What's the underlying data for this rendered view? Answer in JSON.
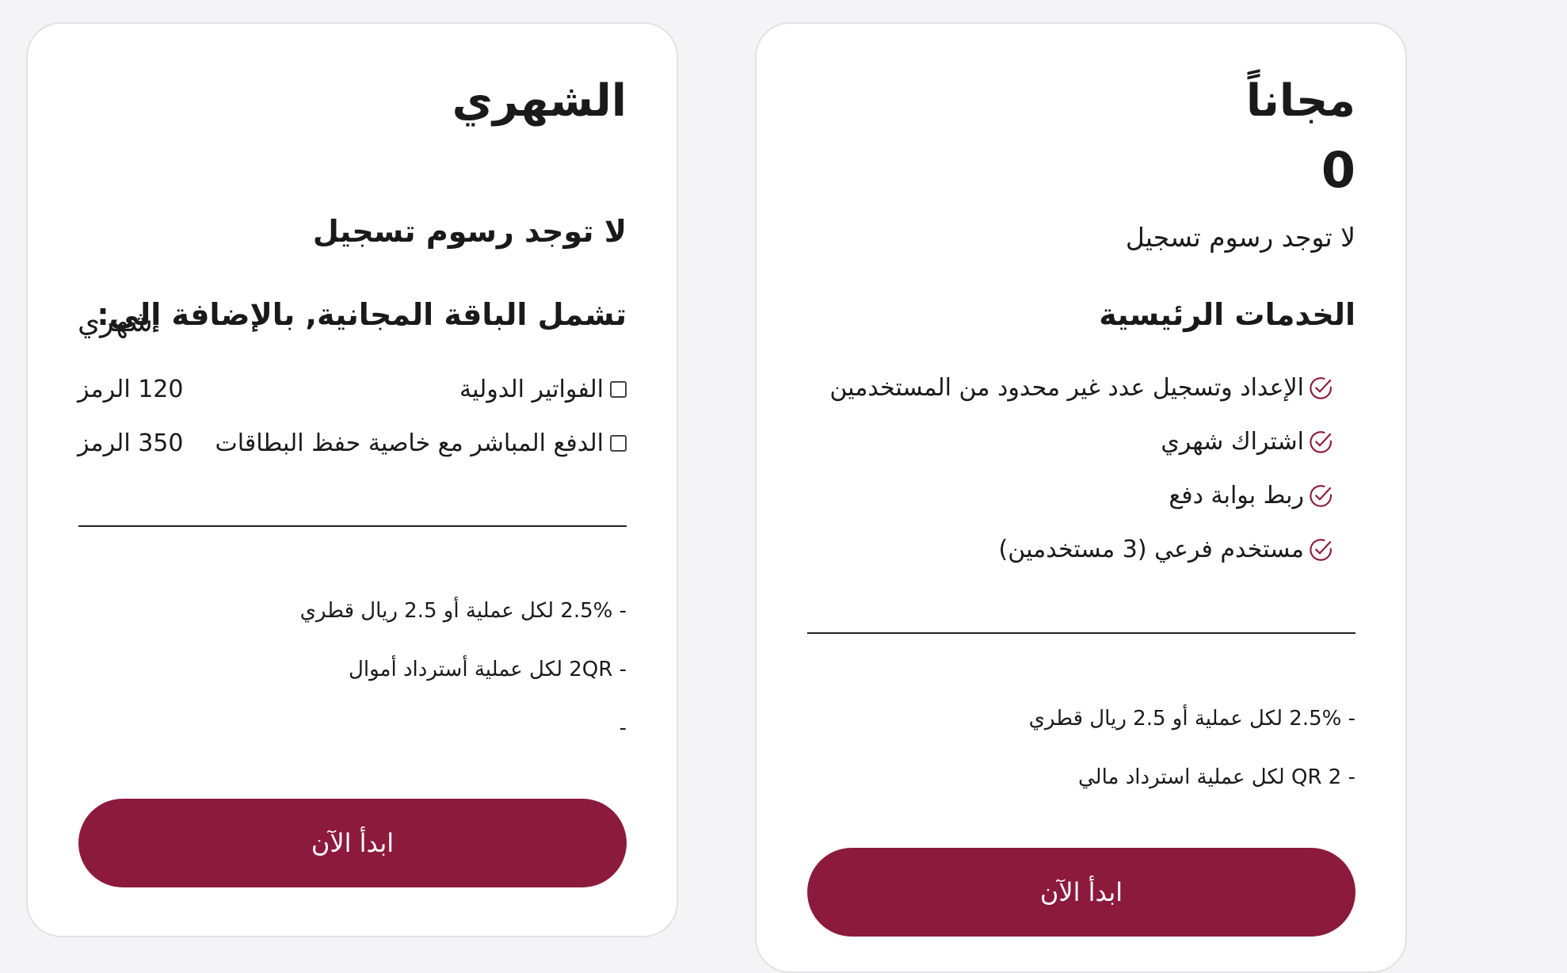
{
  "monthly": {
    "title": "الشهري",
    "no_fee": "لا توجد رسوم تسجيل",
    "includes_heading": "تشمل الباقة المجانية, بالإضافة إلى:",
    "period_label": "شهري",
    "addons": [
      {
        "label": "الفواتير الدولية",
        "price": "120 الرمز"
      },
      {
        "label": "الدفع المباشر مع خاصية حفظ البطاقات",
        "price": "350 الرمز"
      }
    ],
    "fees": [
      "- 2.5% لكل عملية أو 2.5 ريال قطري",
      "- 2QR لكل عملية أسترداد أموال",
      "-"
    ],
    "cta": "ابدأ الآن"
  },
  "free": {
    "title": "مجاناً",
    "price": "0",
    "no_fee": "لا توجد رسوم تسجيل",
    "services_heading": "الخدمات الرئيسية",
    "features": [
      "الإعداد وتسجيل عدد غير محدود من المستخدمين",
      "اشتراك شهري",
      "ربط بوابة دفع",
      "مستخدم فرعي (3 مستخدمين)"
    ],
    "fees": [
      "- 2.5% لكل عملية أو 2.5 ريال قطري",
      "- QR 2 لكل عملية استرداد مالي"
    ],
    "cta": "ابدأ الآن"
  },
  "colors": {
    "brand": "#8c1a3c",
    "page_bg": "#f4f4f6",
    "card_border": "#e2e2e6"
  },
  "icons": {
    "feature_check": "check-circle-icon",
    "addon_toggle": "checkbox"
  }
}
